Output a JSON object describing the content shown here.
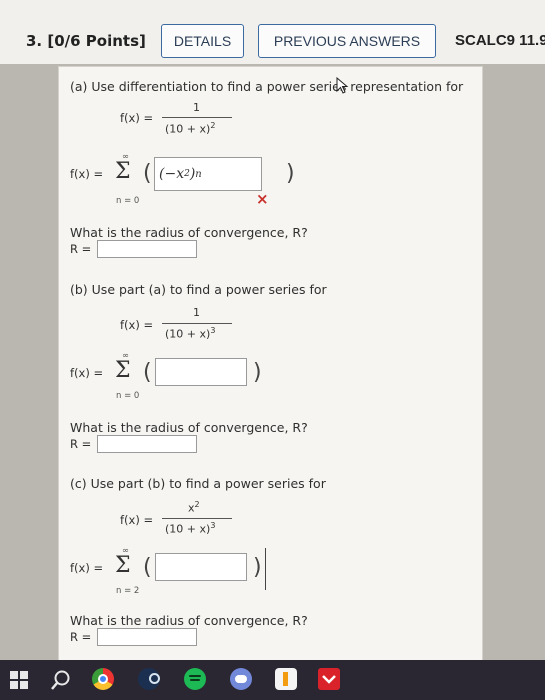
{
  "header": {
    "question_number": "3.",
    "points": "[0/6 Points]",
    "details_label": "DETAILS",
    "previous_answers_label": "PREVIOUS ANSWERS",
    "course_code": "SCALC9 11.9"
  },
  "part_a": {
    "prompt": "(a) Use differentiation to find a power series representation for",
    "function_lhs": "f(x) =",
    "numerator": "1",
    "denominator": "(10 + x)",
    "den_power": "2",
    "series_lhs": "f(x) =",
    "sum_upper": "∞",
    "sum_lower": "n = 0",
    "answer_base": "(−x",
    "answer_exp_inner": "2",
    "answer_close": ")",
    "answer_exp": "n",
    "status": "×",
    "radius_question": "What is the radius of convergence, R?",
    "radius_label": "R =",
    "radius_value": ""
  },
  "part_b": {
    "prompt": "(b) Use part (a) to find a power series for",
    "function_lhs": "f(x) =",
    "numerator": "1",
    "denominator": "(10 + x)",
    "den_power": "3",
    "series_lhs": "f(x) =",
    "sum_upper": "∞",
    "sum_lower": "n = 0",
    "answer_value": "",
    "radius_question": "What is the radius of convergence, R?",
    "radius_label": "R =",
    "radius_value": ""
  },
  "part_c": {
    "prompt": "(c) Use part (b) to find a power series for",
    "function_lhs": "f(x) =",
    "numerator": "x",
    "num_power": "2",
    "denominator": "(10 + x)",
    "den_power": "3",
    "series_lhs": "f(x) =",
    "sum_upper": "∞",
    "sum_lower": "n = 2",
    "answer_value": "",
    "radius_question": "What is the radius of convergence, R?",
    "radius_label": "R =",
    "radius_value": ""
  },
  "taskbar": {
    "icons": [
      "windows-icon",
      "search-icon",
      "chrome-icon",
      "steam-icon",
      "spotify-icon",
      "discord-icon",
      "lunar-client-icon",
      "app-icon"
    ]
  },
  "colors": {
    "accent": "#3b6aa0",
    "error": "#c8312b",
    "taskbar": "#2a2732"
  }
}
